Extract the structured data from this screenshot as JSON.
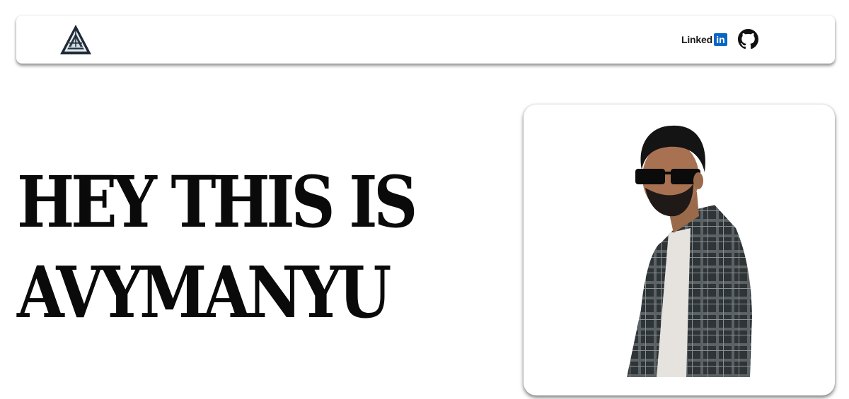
{
  "navbar": {
    "logo": {
      "icon": "triangle-logo-icon"
    },
    "links": {
      "linkedin": {
        "text": "Linked",
        "badge": "in",
        "icon": "linkedin-icon",
        "color": "#0a66c2"
      },
      "github": {
        "icon": "github-icon"
      }
    }
  },
  "hero": {
    "title_line1": "HEY THIS IS",
    "title_line2": "AVYMANYU"
  },
  "photo": {
    "subject": "profile-photo"
  }
}
